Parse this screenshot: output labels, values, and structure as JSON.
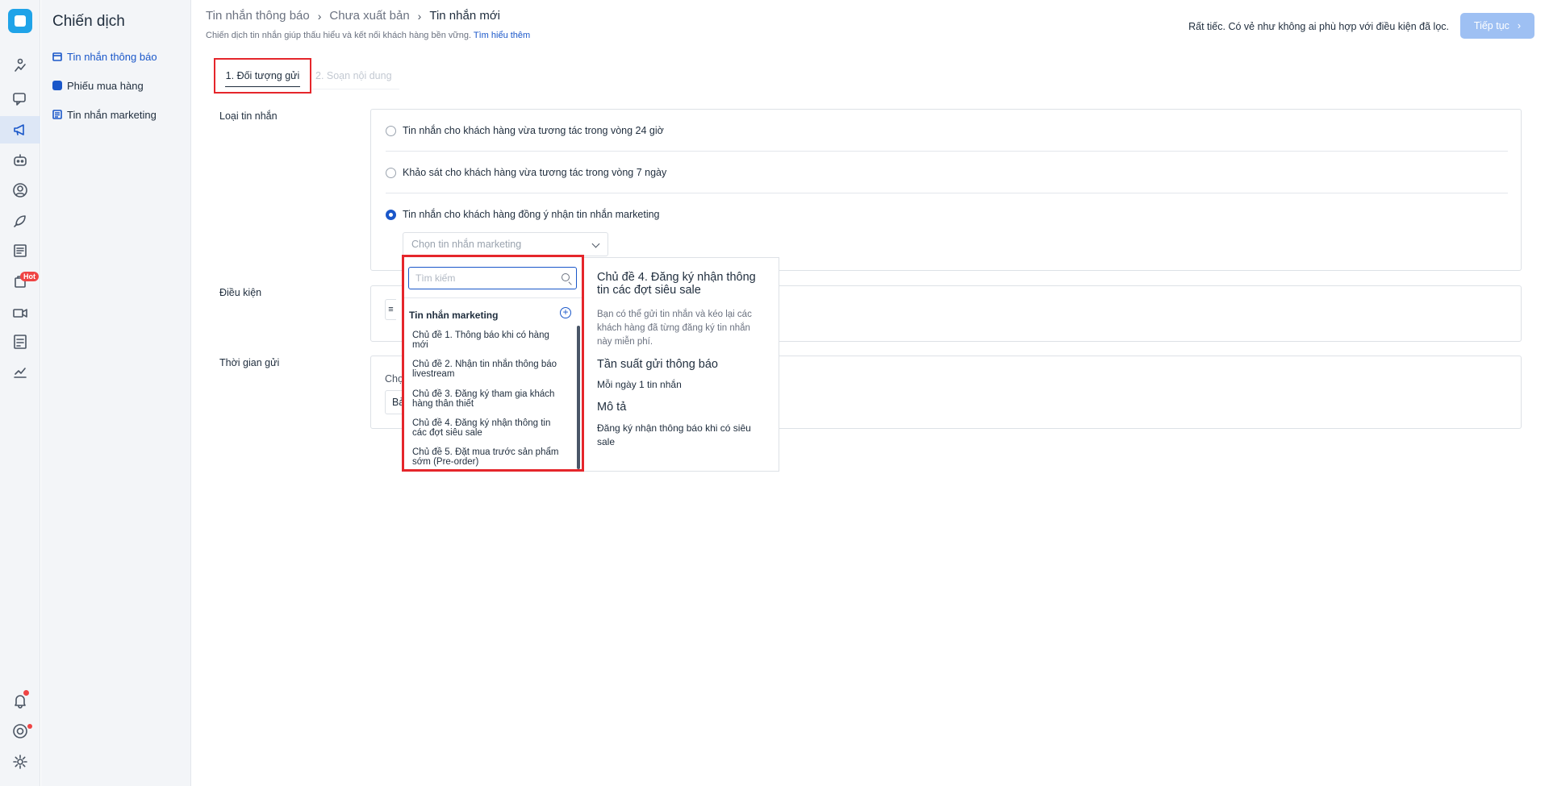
{
  "rail": {
    "hot_badge": "Hot",
    "icons": [
      "logo-icon",
      "analytics-icon",
      "chat-icon",
      "megaphone-icon",
      "bot-icon",
      "user-icon",
      "rocket-icon",
      "news-icon",
      "shop-icon",
      "video-icon",
      "report-icon",
      "chart-icon",
      "bell-icon",
      "support-icon",
      "gear-icon"
    ]
  },
  "subnav": {
    "title": "Chiến dịch",
    "items": [
      {
        "label": "Tin nhắn thông báo"
      },
      {
        "label": "Phiếu mua hàng"
      },
      {
        "label": "Tin nhắn marketing"
      }
    ]
  },
  "breadcrumb": {
    "items": [
      "Tin nhắn thông báo",
      "Chưa xuất bản",
      "Tin nhắn mới"
    ]
  },
  "subtitle": {
    "text": "Chiến dịch tin nhắn giúp thấu hiểu và kết nối khách hàng bền vững.",
    "link": "Tìm hiểu thêm"
  },
  "header": {
    "message": "Rất tiếc. Có vẻ như không ai phù hợp với điều kiện đã lọc.",
    "next_button": "Tiếp tục"
  },
  "steps": {
    "step1": "1. Đối tượng gửi",
    "step2": "2. Soạn nội dung"
  },
  "form": {
    "message_type_label": "Loại tin nhắn",
    "condition_label": "Điều kiện",
    "send_time_label": "Thời gian gửi",
    "options": [
      {
        "label": "Tin nhắn cho khách hàng vừa tương tác trong vòng 24 giờ",
        "selected": false
      },
      {
        "label": "Khảo sát cho khách hàng vừa tương tác trong vòng 7 ngày",
        "selected": false
      },
      {
        "label": "Tin nhắn cho khách hàng đồng ý nhận tin nhắn marketing",
        "selected": true
      }
    ],
    "select_placeholder": "Chọn tin nhắn marketing",
    "time_label_partial": "Chọ",
    "time_value_partial": "Bả"
  },
  "dropdown": {
    "search_placeholder": "Tìm kiếm",
    "group_title": "Tin nhắn marketing",
    "items": [
      "Chủ đề 1. Thông báo khi có hàng mới",
      "Chủ đề 2. Nhận tin nhắn thông báo livestream",
      "Chủ đề 3. Đăng ký tham gia khách hàng thân thiết",
      "Chủ đề 4. Đăng ký nhận thông tin các đợt siêu sale",
      "Chủ đề 5. Đặt mua trước sản phẩm sớm (Pre-order)"
    ]
  },
  "preview": {
    "title": "Chủ đề 4. Đăng ký nhận thông tin các đợt siêu sale",
    "description": "Bạn có thể gửi tin nhắn và kéo lại các khách hàng đã từng đăng ký tin nhắn này miễn phí.",
    "frequency_heading": "Tần suất gửi thông báo",
    "frequency_value": "Mỗi ngày 1 tin nhắn",
    "desc_heading": "Mô tả",
    "desc_value": "Đăng ký nhận thông báo khi có siêu sale"
  },
  "colors": {
    "accent": "#1a57c9",
    "highlight": "#e5262b",
    "disabled_button": "#9ec0f3"
  }
}
